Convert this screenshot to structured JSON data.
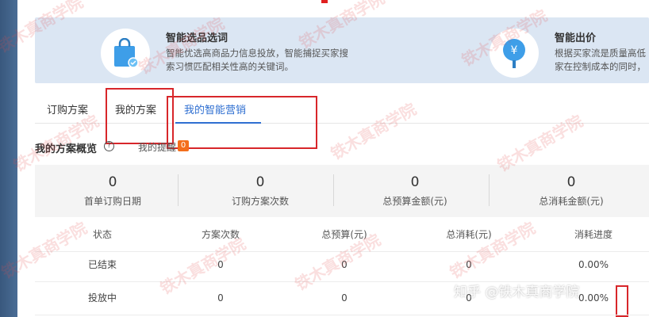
{
  "banner": {
    "card1": {
      "title": "智能选品选词",
      "desc": "智能优选高商品力信息投放，智能捕捉买家搜索习惯匹配相关性高的关键词。",
      "icon": "shopping-bag-icon"
    },
    "card2": {
      "title": "智能出价",
      "desc": "根据买家流是质量高低家在控制成本的同时，",
      "icon": "yen-pin-icon"
    }
  },
  "tabs": [
    {
      "label": "订购方案"
    },
    {
      "label": "我的方案"
    },
    {
      "label": "我的智能营销"
    }
  ],
  "overview": {
    "title": "我的方案概览",
    "help_icon": "question-circle-icon",
    "remind_label": "我的提醒",
    "remind_count": "0"
  },
  "stats": [
    {
      "value": "0",
      "label": "首单订购日期"
    },
    {
      "value": "0",
      "label": "订购方案次数"
    },
    {
      "value": "0",
      "label": "总预算金额(元)"
    },
    {
      "value": "0",
      "label": "总消耗金额(元)"
    }
  ],
  "table": {
    "headers": [
      "状态",
      "方案次数",
      "总预算(元)",
      "总消耗(元)",
      "消耗进度"
    ],
    "rows": [
      [
        "已结束",
        "0",
        "0",
        "0",
        "0.00%"
      ],
      [
        "投放中",
        "0",
        "0",
        "0",
        "0.00%"
      ]
    ]
  },
  "watermark_text": "铁木真商学院",
  "zhihu_watermark": "知乎 @铁木真商学院",
  "colors": {
    "accent": "#2f6fd1",
    "banner_bg": "#dbe6f3",
    "highlight_box": "#d8262a",
    "badge": "#f36e1c",
    "sidebar": "#3a5d84"
  }
}
